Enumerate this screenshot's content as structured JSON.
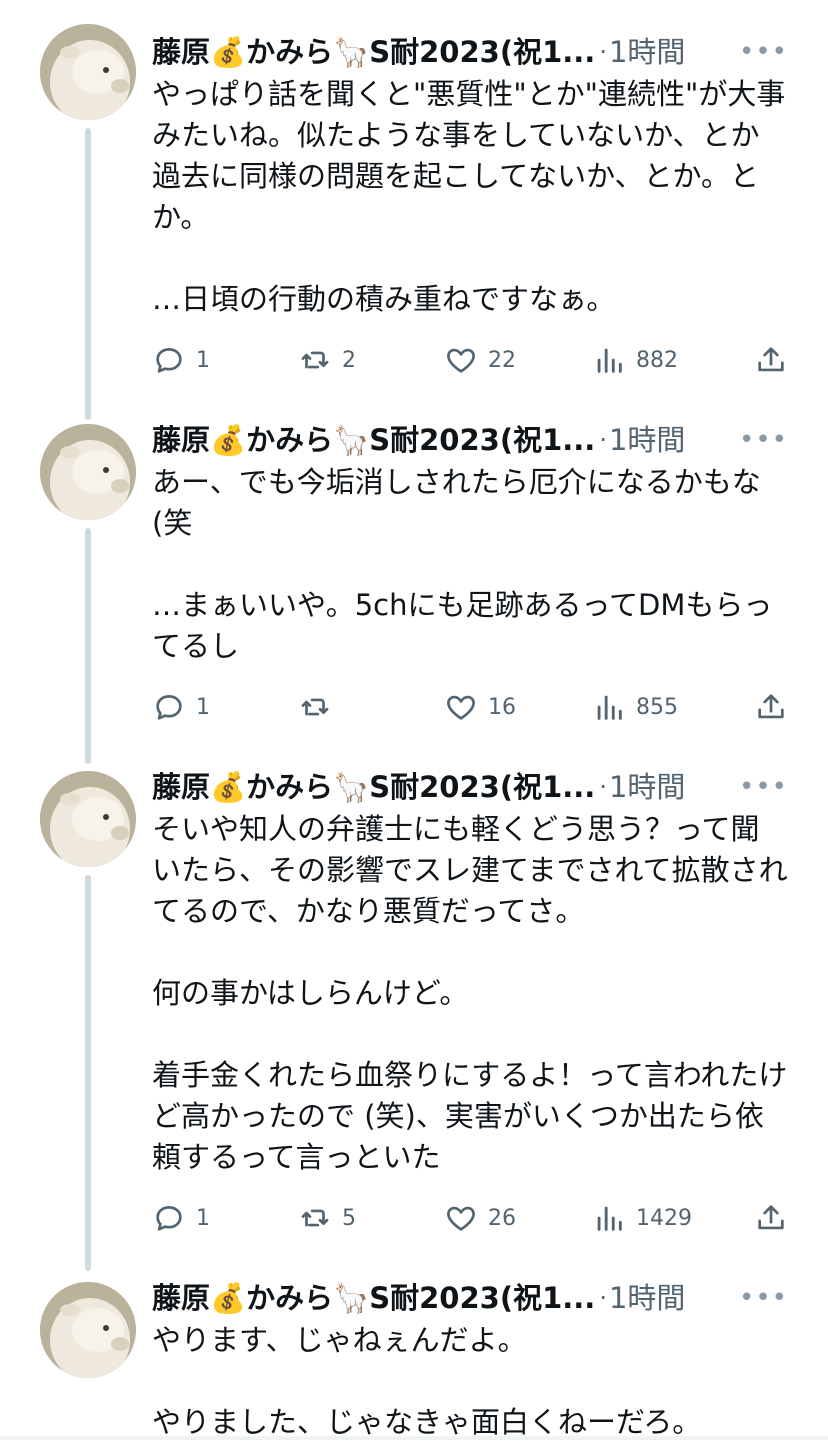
{
  "tweets": [
    {
      "name": "藤原💰かみら🦙S耐2023(祝1...",
      "time": "1時間",
      "text": "やっぱり話を聞くと\"悪質性\"とか\"連続性\"が大事みたいね。似たような事をしていないか、とか過去に同様の問題を起こしてないか、とか。とか。\n\n…日頃の行動の積み重ねですなぁ。",
      "replies": "1",
      "retweets": "2",
      "likes": "22",
      "views": "882"
    },
    {
      "name": "藤原💰かみら🦙S耐2023(祝1...",
      "time": "1時間",
      "text": "あー、でも今垢消しされたら厄介になるかもな (笑\n\n…まぁいいや。5chにも足跡あるってDMもらってるし",
      "replies": "1",
      "retweets": "",
      "likes": "16",
      "views": "855"
    },
    {
      "name": "藤原💰かみら🦙S耐2023(祝1...",
      "time": "1時間",
      "text": "そいや知人の弁護士にも軽くどう思う？って聞いたら、その影響でスレ建てまでされて拡散されてるので、かなり悪質だってさ。\n\n何の事かはしらんけど。\n\n着手金くれたら血祭りにするよ！って言われたけど高かったので (笑)、実害がいくつか出たら依頼するって言っといた",
      "replies": "1",
      "retweets": "5",
      "likes": "26",
      "views": "1429"
    },
    {
      "name": "藤原💰かみら🦙S耐2023(祝1...",
      "time": "1時間",
      "text": "やります、じゃねぇんだよ。\n\nやりました、じゃなきゃ面白くねーだろ。"
    }
  ]
}
